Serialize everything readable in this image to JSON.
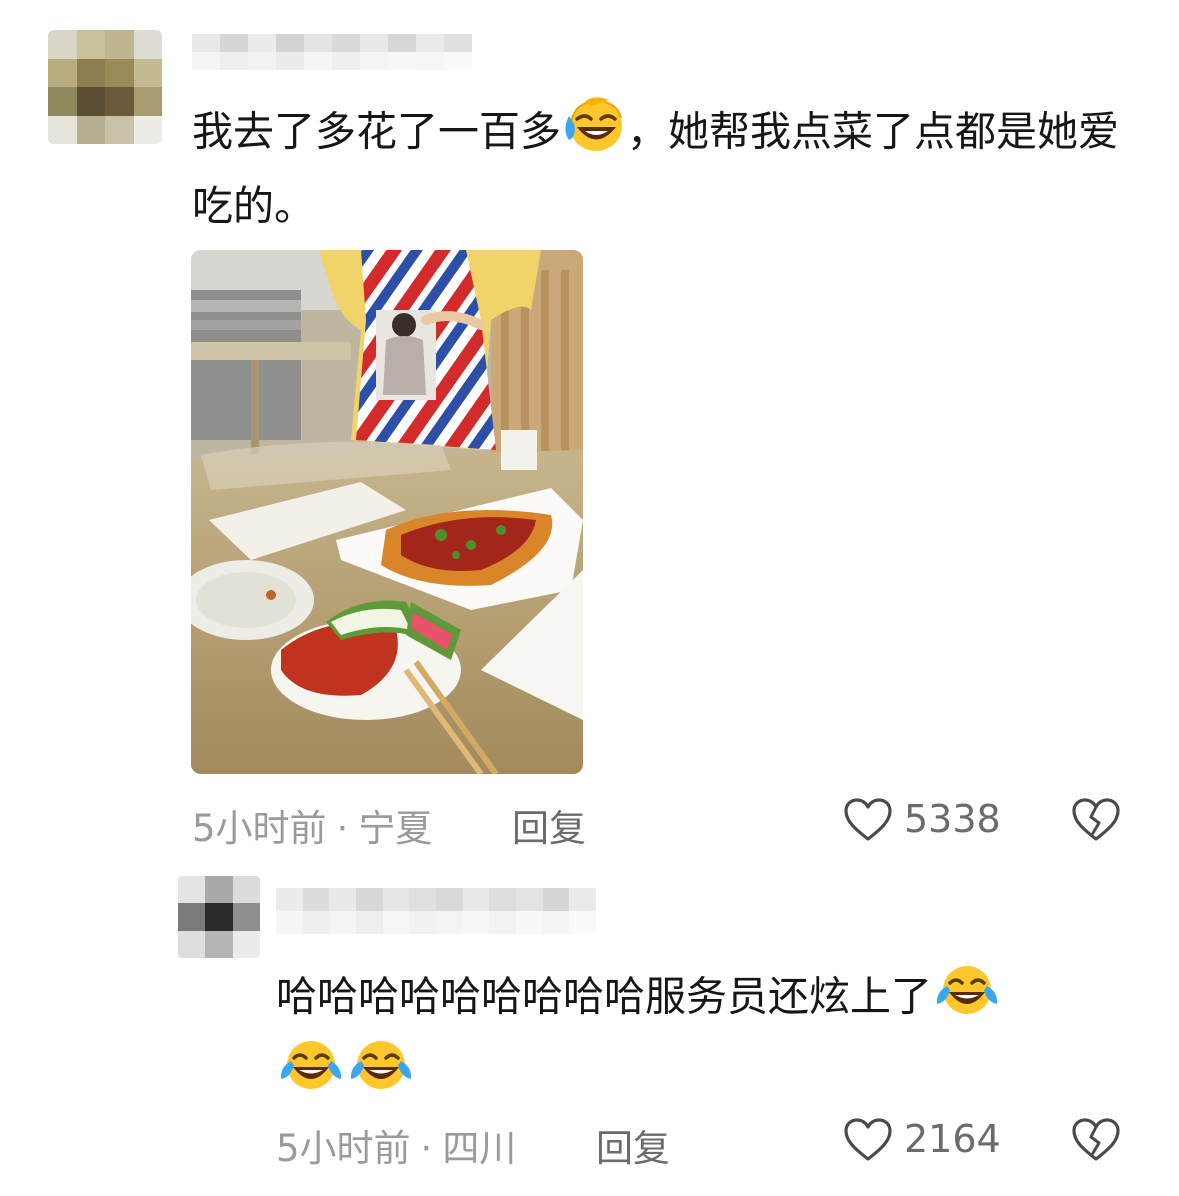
{
  "comments": [
    {
      "text_part1": "我去了多花了一百多",
      "text_part2": "，她帮我点菜了点都是她爱吃的。",
      "time": "5小时前",
      "location": "宁夏",
      "reply_label": "回复",
      "likes": "5338"
    },
    {
      "text": "哈哈哈哈哈哈哈哈哈服务员还炫上了",
      "time": "5小时前",
      "location": "四川",
      "reply_label": "回复",
      "likes": "2164"
    }
  ],
  "meta_separator": "·",
  "icons": {
    "like": "heart-outline-icon",
    "dislike": "broken-heart-icon",
    "emoji_1": "sweat-smile-laugh-icon",
    "emoji_2": "tears-of-joy-icon"
  },
  "colors": {
    "text": "#161616",
    "meta": "#9a9a9a",
    "action": "#6b6b6b",
    "emoji_face": "#ffc72c"
  }
}
